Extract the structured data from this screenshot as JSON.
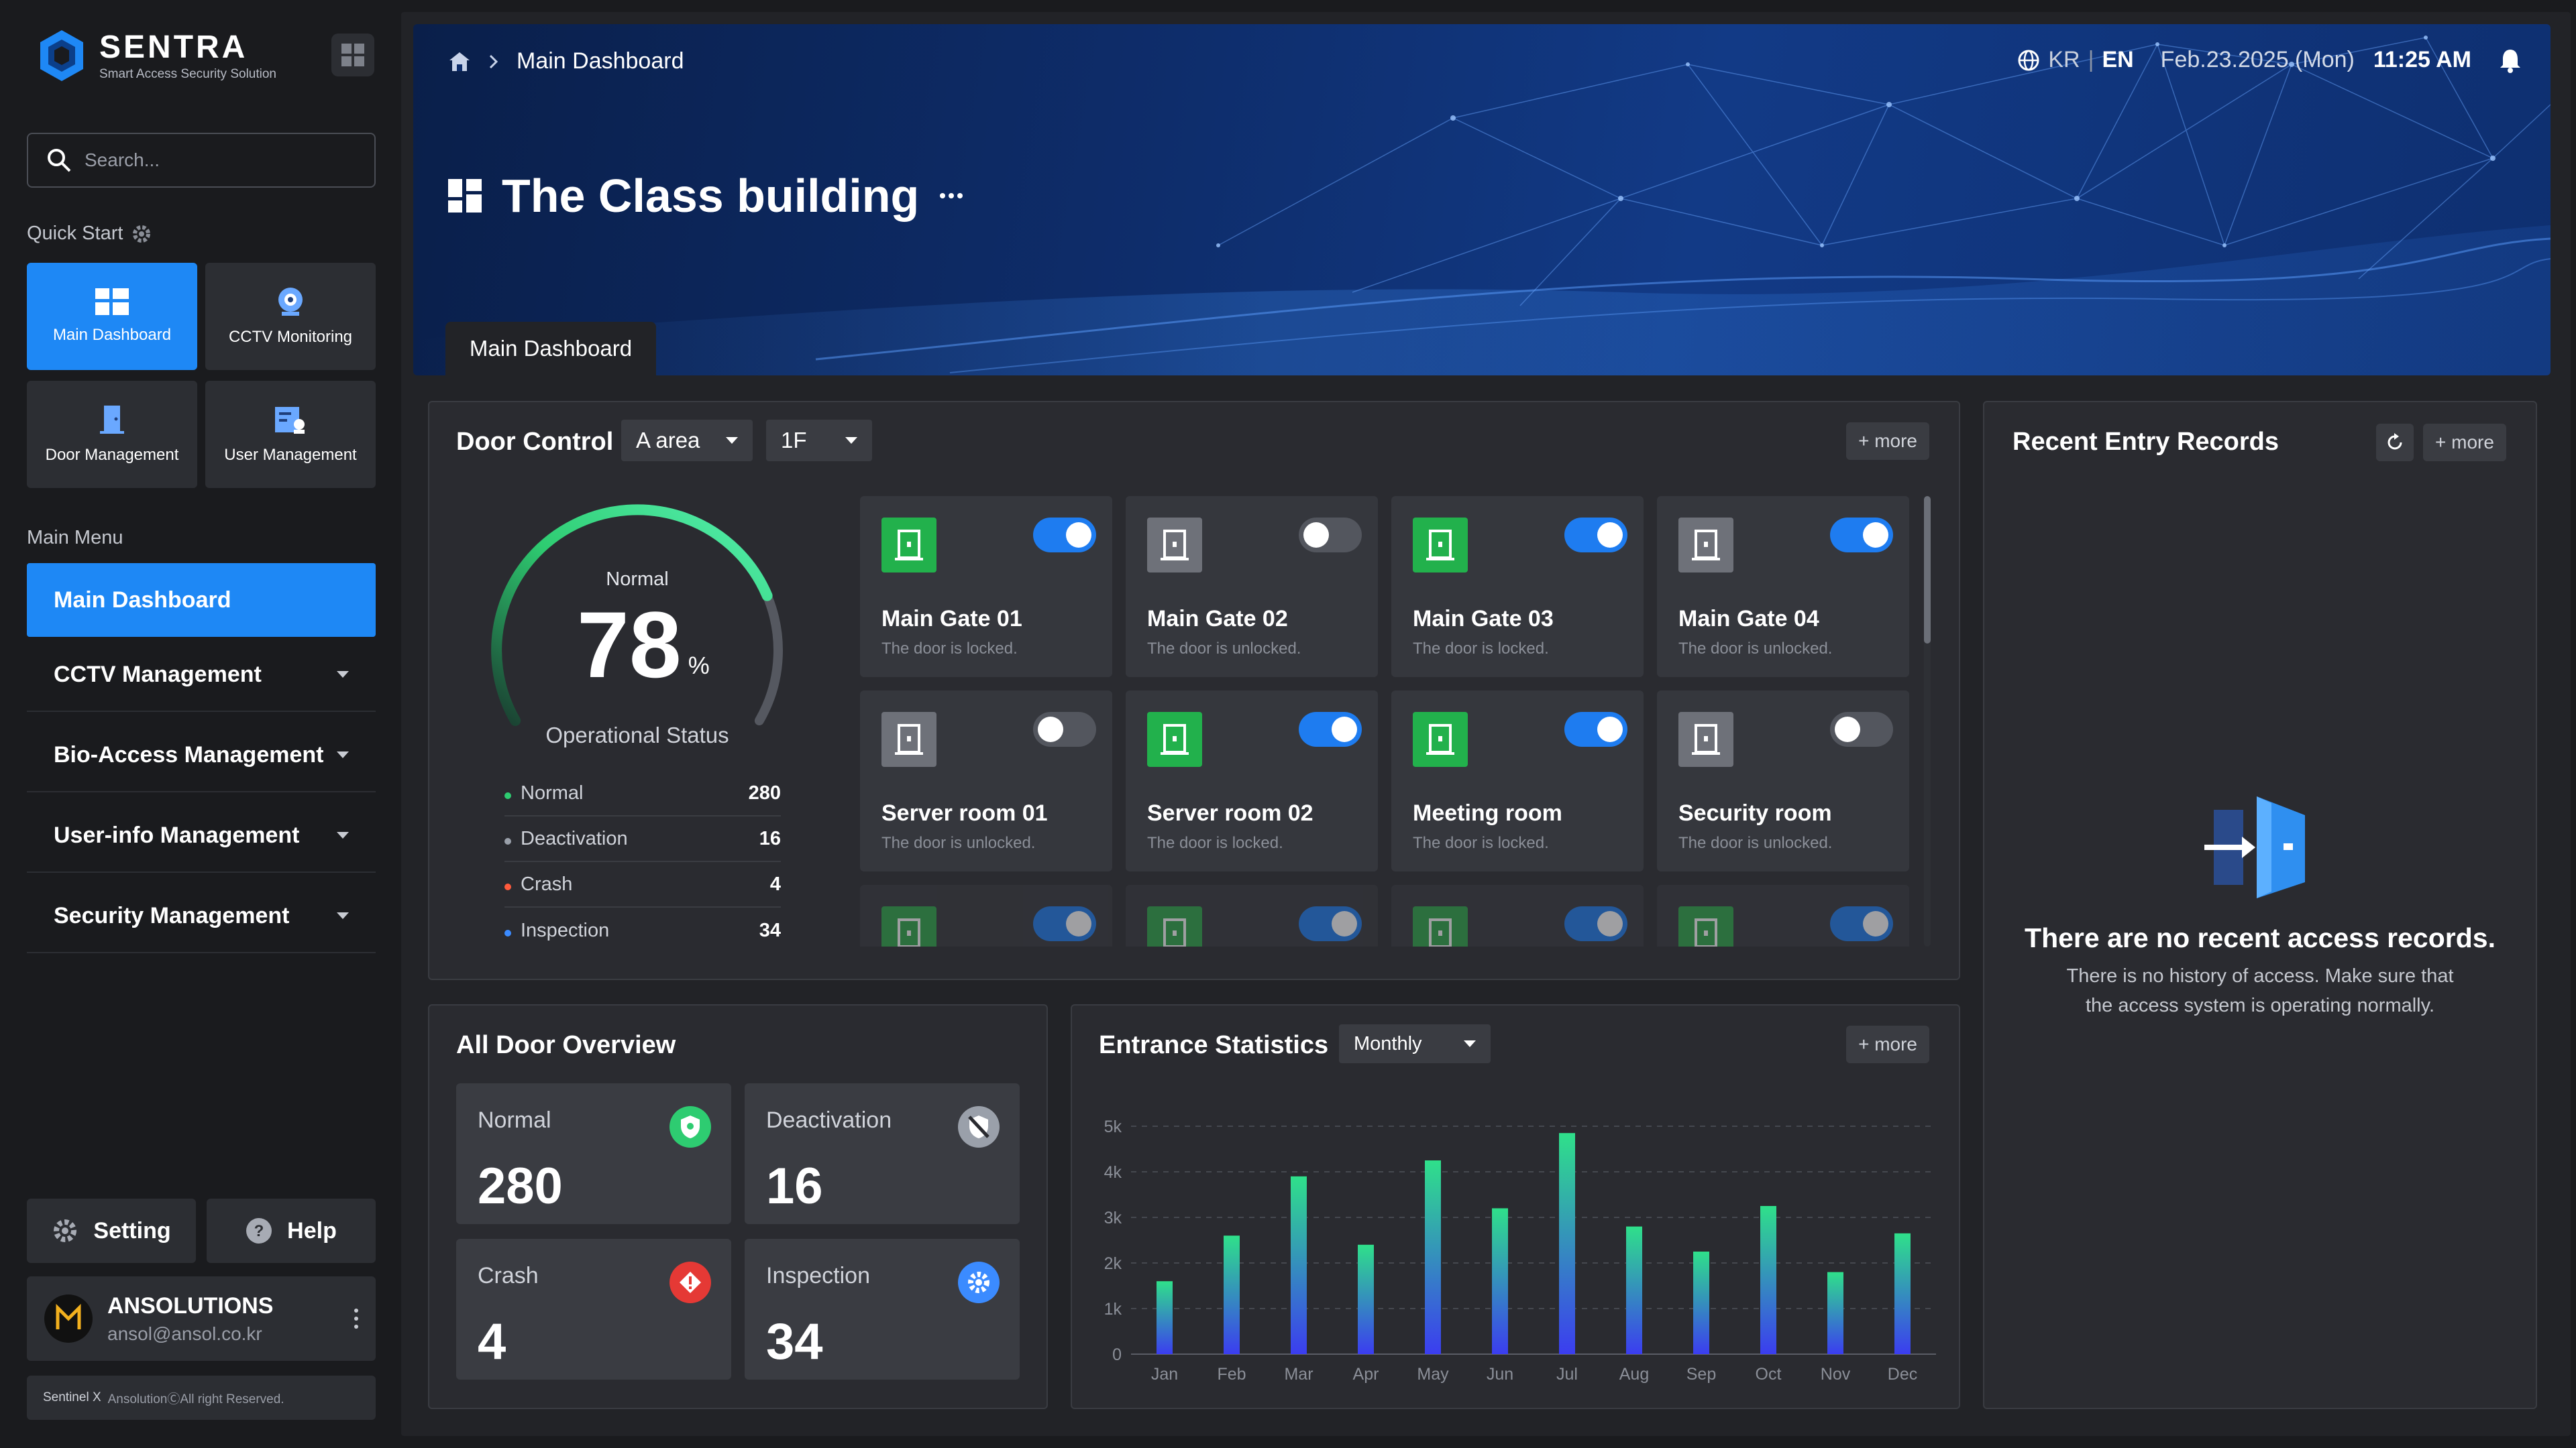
{
  "brand": {
    "name": "SENTRA",
    "tagline": "Smart Access Security Solution"
  },
  "search": {
    "placeholder": "Search..."
  },
  "quick_start": {
    "title": "Quick Start",
    "tiles": [
      {
        "label": "Main Dashboard",
        "icon": "dashboard-icon",
        "active": true
      },
      {
        "label": "CCTV Monitoring",
        "icon": "camera-icon",
        "active": false
      },
      {
        "label": "Door Management",
        "icon": "door-icon",
        "active": false
      },
      {
        "label": "User Management",
        "icon": "user-card-icon",
        "active": false
      }
    ]
  },
  "main_menu": {
    "title": "Main Menu",
    "items": [
      {
        "label": "Main Dashboard",
        "active": true
      },
      {
        "label": "CCTV Management",
        "active": false
      },
      {
        "label": "Bio-Access Management",
        "active": false
      },
      {
        "label": "User-info Management",
        "active": false
      },
      {
        "label": "Security Management",
        "active": false
      }
    ]
  },
  "footer": {
    "setting_label": "Setting",
    "help_label": "Help",
    "user": {
      "name": "ANSOLUTIONS",
      "email": "ansol@ansol.co.kr"
    },
    "copyright_product": "Sentinel X",
    "copyright_text": "AnsolutionⒸAll right Reserved."
  },
  "header": {
    "breadcrumb": "Main Dashboard",
    "lang_kr": "KR",
    "lang_sep": "|",
    "lang_en": "EN",
    "date": "Feb.23.2025 (Mon)",
    "time": "11:25 AM",
    "title": "The Class building",
    "tab": "Main Dashboard"
  },
  "door_control": {
    "title": "Door Control",
    "area_select": "A area",
    "floor_select": "1F",
    "more_label": "+ more",
    "gauge": {
      "status": "Normal",
      "value": 78,
      "unit": "%",
      "caption": "Operational Status"
    },
    "stats": [
      {
        "label": "Normal",
        "value": "280",
        "color": "#2ecc71"
      },
      {
        "label": "Deactivation",
        "value": "16",
        "color": "#9aa0aa"
      },
      {
        "label": "Crash",
        "value": "4",
        "color": "#ff5a3c"
      },
      {
        "label": "Inspection",
        "value": "34",
        "color": "#3b8bff"
      }
    ],
    "doors": [
      {
        "name": "Main Gate 01",
        "status": "The door is locked.",
        "on": true
      },
      {
        "name": "Main Gate 02",
        "status": "The door is unlocked.",
        "on": false
      },
      {
        "name": "Main Gate 03",
        "status": "The door is locked.",
        "on": true
      },
      {
        "name": "Main Gate 04",
        "status": "The door is unlocked.",
        "on": true
      },
      {
        "name": "Server room 01",
        "status": "The door is unlocked.",
        "on": false
      },
      {
        "name": "Server room 02",
        "status": "The door is locked.",
        "on": true
      },
      {
        "name": "Meeting room",
        "status": "The door is locked.",
        "on": true
      },
      {
        "name": "Security room",
        "status": "The door is unlocked.",
        "on": false
      },
      {
        "name": "",
        "status": "",
        "on": true
      },
      {
        "name": "",
        "status": "",
        "on": true
      },
      {
        "name": "",
        "status": "",
        "on": true
      },
      {
        "name": "",
        "status": "",
        "on": true
      }
    ]
  },
  "overview": {
    "title": "All Door Overview",
    "cards": [
      {
        "label": "Normal",
        "value": "280",
        "icon": "shield-check-icon",
        "color": "#2ecc71"
      },
      {
        "label": "Deactivation",
        "value": "16",
        "icon": "shield-off-icon",
        "color": "#9aa0aa"
      },
      {
        "label": "Crash",
        "value": "4",
        "icon": "alert-diamond-icon",
        "color": "#e53935"
      },
      {
        "label": "Inspection",
        "value": "34",
        "icon": "gear-icon",
        "color": "#3b8bff"
      }
    ]
  },
  "entrance_stats": {
    "title": "Entrance Statistics",
    "period_select": "Monthly",
    "more_label": "+ more"
  },
  "chart_data": {
    "type": "bar",
    "categories": [
      "Jan",
      "Feb",
      "Mar",
      "Apr",
      "May",
      "Jun",
      "Jul",
      "Aug",
      "Sep",
      "Oct",
      "Nov",
      "Dec"
    ],
    "values": [
      1600,
      2600,
      3900,
      2400,
      4250,
      3200,
      4850,
      2800,
      2250,
      3250,
      1800,
      2650
    ],
    "yticks": [
      "0",
      "1k",
      "2k",
      "3k",
      "4k",
      "5k"
    ],
    "ylim": [
      0,
      5000
    ],
    "grid": true,
    "colors": {
      "top": "#2fe08a",
      "bottom": "#3b3df0"
    }
  },
  "recent_entries": {
    "title": "Recent Entry Records",
    "more_label": "+ more",
    "empty_title": "There are no recent access records.",
    "empty_line1": "There is no history of access. Make sure that",
    "empty_line2": "the access system is operating normally."
  }
}
